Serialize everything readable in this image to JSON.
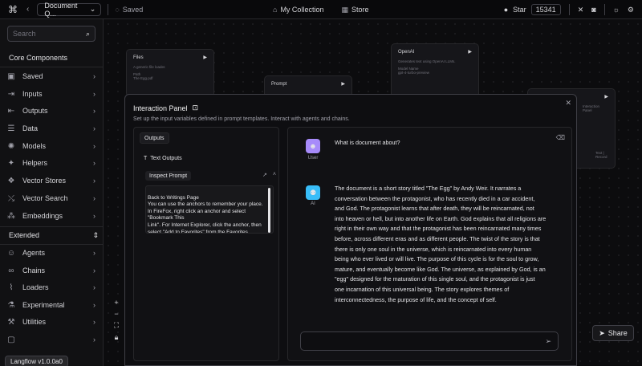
{
  "topbar": {
    "project_name": "Document Q...",
    "saved_label": "Saved",
    "nav_collection": "My Collection",
    "nav_store": "Store",
    "star_label": "Star",
    "star_count": "15341"
  },
  "sidebar": {
    "search_placeholder": "Search",
    "core_title": "Core Components",
    "core_items": [
      {
        "label": "Saved"
      },
      {
        "label": "Inputs"
      },
      {
        "label": "Outputs"
      },
      {
        "label": "Data"
      },
      {
        "label": "Models"
      },
      {
        "label": "Helpers"
      },
      {
        "label": "Vector Stores"
      },
      {
        "label": "Vector Search"
      },
      {
        "label": "Embeddings"
      }
    ],
    "extended_title": "Extended",
    "extended_items": [
      {
        "label": "Agents"
      },
      {
        "label": "Chains"
      },
      {
        "label": "Loaders"
      },
      {
        "label": "Experimental"
      },
      {
        "label": "Utilities"
      }
    ],
    "version": "Langflow v1.0.0a0"
  },
  "canvas": {
    "node_files": "Files",
    "node_files_sub": "A generic file loader.",
    "node_files_path": "Path",
    "node_files_file": "The Egg.pdf",
    "node_prompt": "Prompt",
    "node_openai": "OpenAI",
    "node_openai_sub": "Generates text using OpenAI LLMs.",
    "node_openai_model_label": "Model Name",
    "node_openai_model": "gpt-4-turbo-preview",
    "node_right_sub": "Interaction Panel",
    "node_right_text": "Text | Record",
    "share_label": "Share",
    "api_fragment": "I"
  },
  "panel": {
    "title": "Interaction Panel",
    "description": "Set up the input variables defined in prompt templates. Interact with agents and chains.",
    "outputs_tab": "Outputs",
    "text_outputs": "Text Outputs",
    "inspect_prompt": "Inspect Prompt",
    "prompt_text": "Back to Writings Page\nYou can use the anchors to remember your place. In FireFox, right click an anchor and select \"Bookmark This\nLink\". For Internet Explorer, click the anchor, then select \"Add to Favorites\" from the Favorites",
    "chat": {
      "user_label": "User",
      "user_message": "What is document about?",
      "ai_label": "AI",
      "ai_lines": [
        "The document is a short story titled \"The Egg\" by Andy Weir. It narrates a",
        "conversation between the protagonist, who has recently died in a car accident,",
        "and God. The protagonist learns that after death, they will be reincarnated, not",
        "into heaven or hell, but into another life on Earth. God explains that all religions are",
        "right in their own way and that the protagonist has been reincarnated many times",
        "before, across different eras and as different people. The twist of the story is that",
        "there is only one soul in the universe, which is reincarnated into every human",
        "being who ever lived or will live. The purpose of this cycle is for the soul to grow,",
        "mature, and eventually become like God. The universe, as explained by God, is an",
        "\"egg\" designed for the maturation of this single soul, and the protagonist is just",
        "one incarnation of this universal being. The story explores themes of",
        "interconnectedness, the purpose of life, and the concept of self."
      ],
      "input_value": ""
    }
  },
  "colors": {
    "user_avatar": "#a78bfa",
    "ai_avatar": "#38bdf8"
  }
}
